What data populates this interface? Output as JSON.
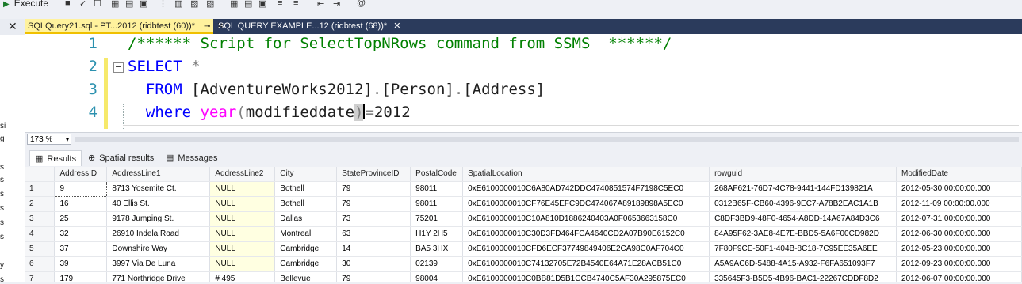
{
  "toolbar": {
    "execute_label": "Execute"
  },
  "editor_tabs": [
    {
      "label": "SQLQuery21.sql - PT...2012 (ridbtest (60))*",
      "pin": "⊸",
      "close": "✕"
    },
    {
      "label": "SQL QUERY EXAMPLE...12 (ridbtest (68))*",
      "close": "✕"
    }
  ],
  "left_strip": {
    "close": "✕",
    "frags": [
      "si",
      "g",
      "s",
      "s",
      "s",
      "s",
      "s",
      "s",
      "y",
      "s"
    ]
  },
  "code_lines": [
    {
      "num": "1",
      "parts": [
        {
          "t": "/****** Script for SelectTopNRows command from SSMS  ******/",
          "c": "cm"
        }
      ]
    },
    {
      "num": "2",
      "parts": [
        {
          "t": "SELECT",
          "c": "kw"
        },
        {
          "t": " *",
          "c": "gr"
        }
      ]
    },
    {
      "num": "3",
      "parts": [
        {
          "t": "  FROM ",
          "c": "kw"
        },
        {
          "t": "[AdventureWorks2012]",
          "c": "ok"
        },
        {
          "t": ".",
          "c": "gr"
        },
        {
          "t": "[Person]",
          "c": "ok"
        },
        {
          "t": ".",
          "c": "gr"
        },
        {
          "t": "[Address]",
          "c": "ok"
        }
      ]
    },
    {
      "num": "4",
      "parts": [
        {
          "t": "  where ",
          "c": "kw"
        },
        {
          "t": "year",
          "c": "fn"
        },
        {
          "t": "(",
          "c": "gr"
        },
        {
          "t": "modifieddate",
          "c": "ok"
        },
        {
          "t": ")",
          "c": "gr hl"
        },
        {
          "t": "CURSOR",
          "c": "cursor"
        },
        {
          "t": "=",
          "c": "gr"
        },
        {
          "t": "2012",
          "c": "ok"
        }
      ]
    }
  ],
  "collapse_glyph": "−",
  "zoom": {
    "value": "173 %",
    "arrow": "▾"
  },
  "result_tabs": [
    {
      "label": "Results",
      "icon": "▦"
    },
    {
      "label": "Spatial results",
      "icon": "⊕"
    },
    {
      "label": "Messages",
      "icon": "▤"
    }
  ],
  "grid": {
    "columns": [
      "",
      "AddressID",
      "AddressLine1",
      "AddressLine2",
      "City",
      "StateProvinceID",
      "PostalCode",
      "SpatialLocation",
      "rowguid",
      "ModifiedDate"
    ],
    "rows": [
      [
        "1",
        "9",
        "8713 Yosemite Ct.",
        "NULL",
        "Bothell",
        "79",
        "98011",
        "0xE6100000010C6A80AD742DDC4740851574F7198C5EC0",
        "268AF621-76D7-4C78-9441-144FD139821A",
        "2012-05-30 00:00:00.000"
      ],
      [
        "2",
        "16",
        "40 Ellis St.",
        "NULL",
        "Bothell",
        "79",
        "98011",
        "0xE6100000010CF76E45EFC9DC474067A89189898A5EC0",
        "0312B65F-CB60-4396-9EC7-A78B2EAC1A1B",
        "2012-11-09 00:00:00.000"
      ],
      [
        "3",
        "25",
        "9178 Jumping St.",
        "NULL",
        "Dallas",
        "73",
        "75201",
        "0xE6100000010C10A810D1886240403A0F0653663158C0",
        "C8DF3BD9-48F0-4654-A8DD-14A67A84D3C6",
        "2012-07-31 00:00:00.000"
      ],
      [
        "4",
        "32",
        "26910 Indela Road",
        "NULL",
        "Montreal",
        "63",
        "H1Y 2H5",
        "0xE6100000010C30D3FD464FCA4640CD2A07B90E6152C0",
        "84A95F62-3AE8-4E7E-BBD5-5A6F00CD982D",
        "2012-06-30 00:00:00.000"
      ],
      [
        "5",
        "37",
        "Downshire Way",
        "NULL",
        "Cambridge",
        "14",
        "BA5 3HX",
        "0xE6100000010CFD6ECF37749849406E2CA98C0AF704C0",
        "7F80F9CE-50F1-404B-8C18-7C95EE35A6EE",
        "2012-05-23 00:00:00.000"
      ],
      [
        "6",
        "39",
        "3997 Via De Luna",
        "NULL",
        "Cambridge",
        "30",
        "02139",
        "0xE6100000010C74132705E72B4540E64A71E28ACB51C0",
        "A5A9AC6D-5488-4A15-A932-F6FA651093F7",
        "2012-09-23 00:00:00.000"
      ],
      [
        "7",
        "179",
        "771 Northridge Drive",
        "# 495",
        "Bellevue",
        "79",
        "98004",
        "0xE6100000010C0BB81D5B1CCB4740C5AF30A295875EC0",
        "335645F3-B5D5-4B96-BAC1-22267CDDF8D2",
        "2012-06-07 00:00:00.000"
      ]
    ]
  }
}
